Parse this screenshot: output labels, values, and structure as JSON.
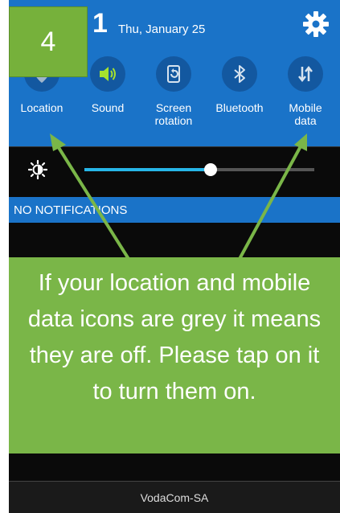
{
  "step": {
    "number": "4"
  },
  "status_bar": {
    "time": "1",
    "date": "Thu, January 25",
    "settings_icon": "gear-icon"
  },
  "quick_toggles": [
    {
      "label": "Location",
      "icon": "location-icon"
    },
    {
      "label": "Sound",
      "icon": "sound-icon"
    },
    {
      "label": "Screen\nrotation",
      "icon": "screen-rotation-icon"
    },
    {
      "label": "Bluetooth",
      "icon": "bluetooth-icon"
    },
    {
      "label": "Mobile\ndata",
      "icon": "mobile-data-icon"
    }
  ],
  "brightness": {
    "icon": "brightness-icon",
    "level": 0.55
  },
  "notifications": {
    "label": "NO NOTIFICATIONS"
  },
  "callout": {
    "text": "If your location and mobile data icons are grey it means they are off. Please tap on it to turn them on."
  },
  "carrier": {
    "label": "VodaCom-SA"
  },
  "colors": {
    "panel_blue": "#1a73c8",
    "toggle_circle": "#1358a0",
    "sound_active": "#a6e22e",
    "callout_green": "#7ab648",
    "slider_fill": "#27b6e8"
  }
}
